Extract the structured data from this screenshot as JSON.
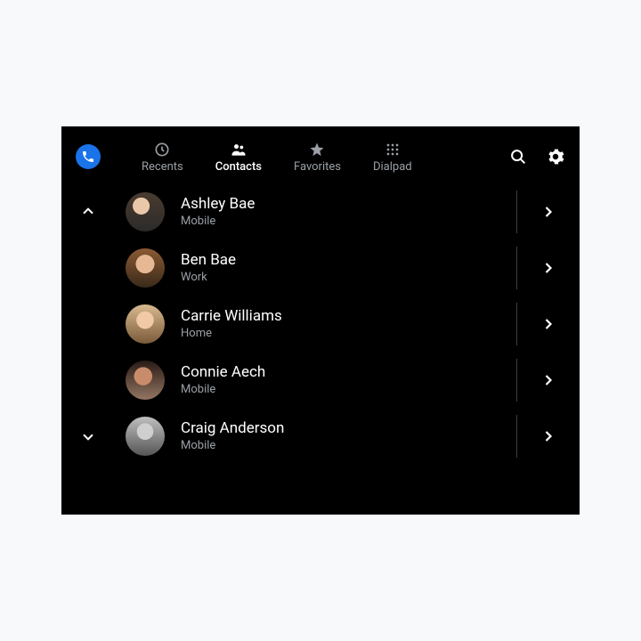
{
  "tabs": [
    {
      "id": "recents",
      "label": "Recents"
    },
    {
      "id": "contacts",
      "label": "Contacts"
    },
    {
      "id": "favorites",
      "label": "Favorites"
    },
    {
      "id": "dialpad",
      "label": "Dialpad"
    }
  ],
  "active_tab": "contacts",
  "contacts": [
    {
      "name": "Ashley Bae",
      "subtitle": "Mobile",
      "avatar_bg": "radial-gradient(circle at 40% 35%, #eac7a9 24%, transparent 25%), linear-gradient(180deg,#4a3b2e 0%,#2b2b2b 100%)",
      "scroll": "up"
    },
    {
      "name": "Ben Bae",
      "subtitle": "Work",
      "avatar_bg": "radial-gradient(circle at 50% 40%, #e6b893 30%, transparent 31%), linear-gradient(180deg,#8a5a33 0%,#3a2a1a 100%)",
      "scroll": null
    },
    {
      "name": "Carrie Williams",
      "subtitle": "Home",
      "avatar_bg": "radial-gradient(circle at 50% 40%, #f1c9a6 28%, transparent 29%), linear-gradient(180deg,#d9b98f 0%,#7a5a3a 100%)",
      "scroll": null
    },
    {
      "name": "Connie Aech",
      "subtitle": "Mobile",
      "avatar_bg": "radial-gradient(circle at 45% 40%, #c98c6a 28%, transparent 29%), linear-gradient(180deg,#2a1a15 0%,#937662 100%)",
      "scroll": null
    },
    {
      "name": "Craig Anderson",
      "subtitle": "Mobile",
      "avatar_bg": "radial-gradient(circle at 50% 38%, #cfcfcf 26%, transparent 27%), linear-gradient(180deg,#bfbfbf 0%,#555 100%)",
      "scroll": "down"
    }
  ]
}
